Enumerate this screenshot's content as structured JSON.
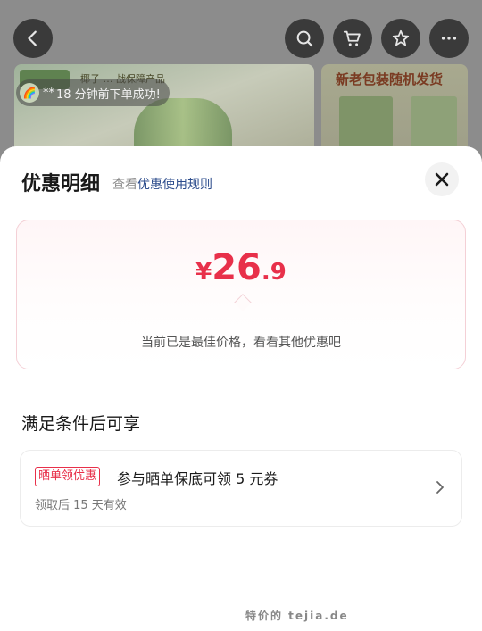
{
  "background": {
    "banner_text": "椰子  … 战保障产品",
    "right_banner_title": "新老包装随机发货",
    "toast": {
      "user": "**",
      "message": "18 分钟前下单成功!"
    }
  },
  "nav": {
    "back_icon": "back-arrow-icon",
    "search_icon": "search-icon",
    "cart_icon": "cart-icon",
    "favorite_icon": "star-icon",
    "more_icon": "more-icon"
  },
  "sheet": {
    "title": "优惠明细",
    "link_prefix": "查看",
    "link": "优惠使用规则",
    "close_icon": "close-icon"
  },
  "price": {
    "currency": "¥",
    "integer": "26",
    "decimal": ".9",
    "note": "当前已是最佳价格，看看其他优惠吧",
    "accent_color": "#e8304a"
  },
  "conditional": {
    "title": "满足条件后可享",
    "coupon": {
      "badge": "晒单领优惠",
      "title": "参与晒单保底可领 5 元券",
      "subtitle": "领取后 15 天有效"
    }
  },
  "watermark": "特价的 tejia.de"
}
